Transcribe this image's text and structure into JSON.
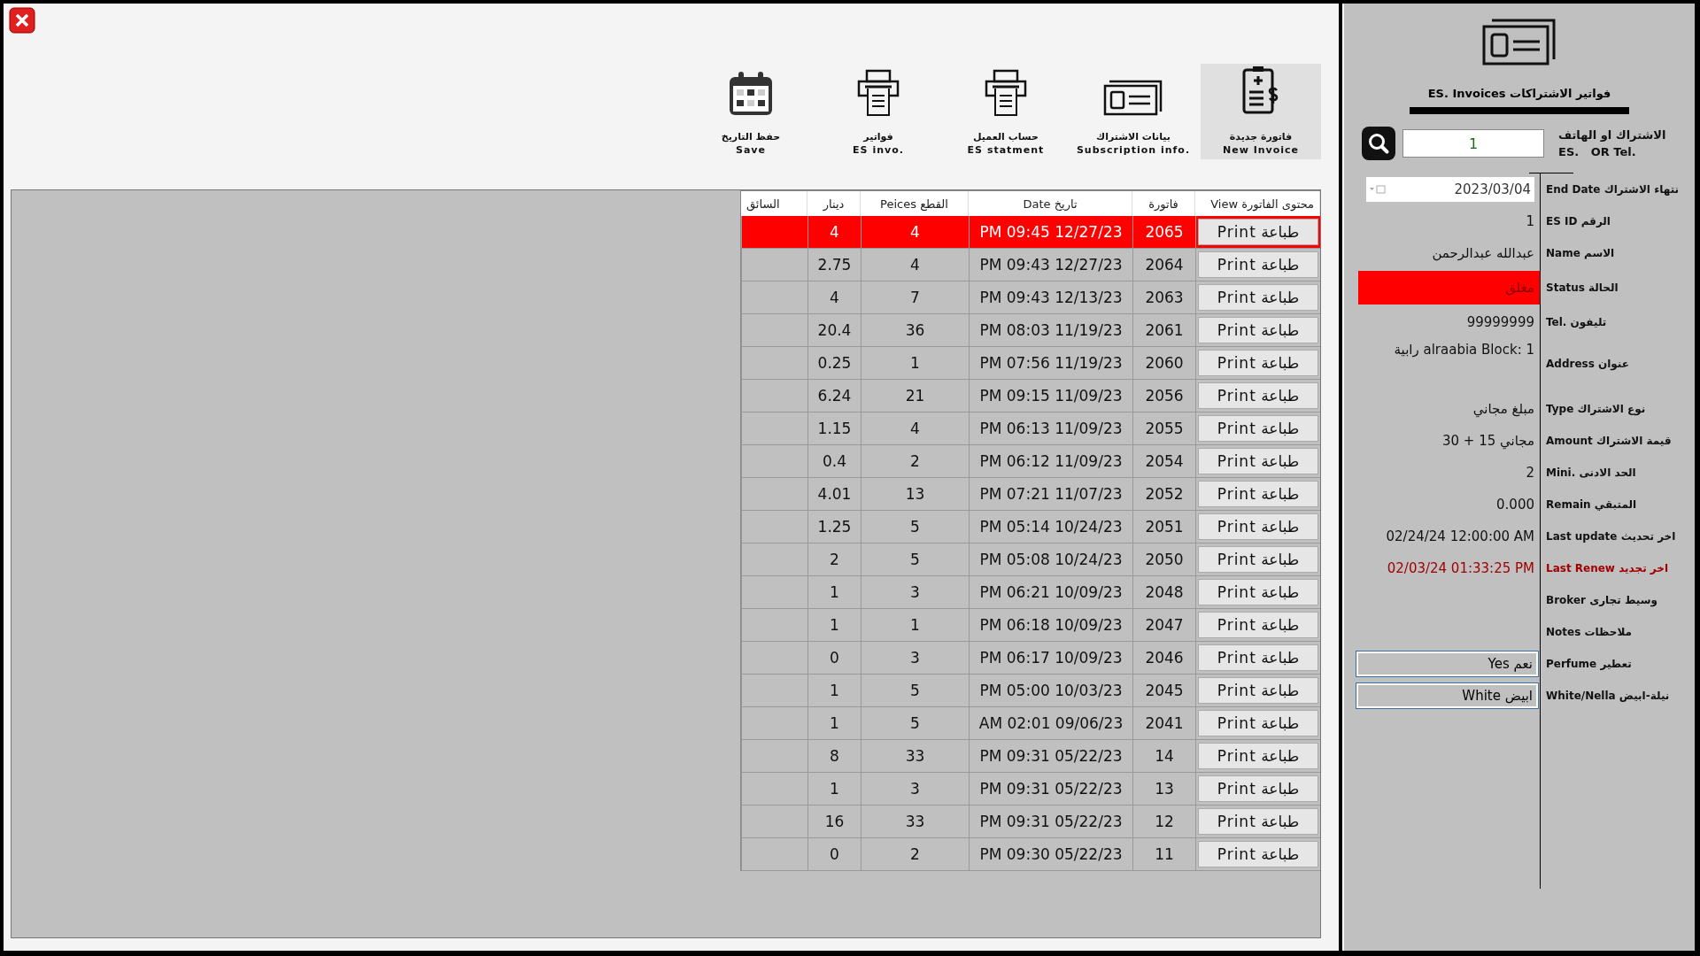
{
  "toolbar": [
    {
      "kind": "invoice",
      "label_ar": "فاتورة جديدة",
      "label_en": "New Invoice",
      "selected": true
    },
    {
      "kind": "card",
      "label_ar": "بيانات الاشتراك",
      "label_en": "Subscription info.",
      "selected": false
    },
    {
      "kind": "printer",
      "label_ar": "حساب العميل",
      "label_en": "ES statment",
      "selected": false
    },
    {
      "kind": "printer",
      "label_ar": "فواتير",
      "label_en": "ES invo.",
      "selected": false
    },
    {
      "kind": "calendar",
      "label_ar": "حفظ التاريخ",
      "label_en": "Save",
      "selected": false
    }
  ],
  "table": {
    "columns": [
      "محتوى الفاتورة View",
      "فاتورة",
      "تاريخ Date",
      "القطع Peices",
      "دينار",
      "السائق"
    ],
    "rows": [
      {
        "selected": true,
        "view": "طباعة Print",
        "invoice": "2065",
        "date": "PM 09:45 12/27/23",
        "pieces": "4",
        "dinar": "4"
      },
      {
        "selected": false,
        "view": "طباعة Print",
        "invoice": "2064",
        "date": "PM 09:43 12/27/23",
        "pieces": "4",
        "dinar": "2.75"
      },
      {
        "selected": false,
        "view": "طباعة Print",
        "invoice": "2063",
        "date": "PM 09:43 12/13/23",
        "pieces": "7",
        "dinar": "4"
      },
      {
        "selected": false,
        "view": "طباعة Print",
        "invoice": "2061",
        "date": "PM 08:03 11/19/23",
        "pieces": "36",
        "dinar": "20.4"
      },
      {
        "selected": false,
        "view": "طباعة Print",
        "invoice": "2060",
        "date": "PM 07:56 11/19/23",
        "pieces": "1",
        "dinar": "0.25"
      },
      {
        "selected": false,
        "view": "طباعة Print",
        "invoice": "2056",
        "date": "PM 09:15 11/09/23",
        "pieces": "21",
        "dinar": "6.24"
      },
      {
        "selected": false,
        "view": "طباعة Print",
        "invoice": "2055",
        "date": "PM 06:13 11/09/23",
        "pieces": "4",
        "dinar": "1.15"
      },
      {
        "selected": false,
        "view": "طباعة Print",
        "invoice": "2054",
        "date": "PM 06:12 11/09/23",
        "pieces": "2",
        "dinar": "0.4"
      },
      {
        "selected": false,
        "view": "طباعة Print",
        "invoice": "2052",
        "date": "PM 07:21 11/07/23",
        "pieces": "13",
        "dinar": "4.01"
      },
      {
        "selected": false,
        "view": "طباعة Print",
        "invoice": "2051",
        "date": "PM 05:14 10/24/23",
        "pieces": "5",
        "dinar": "1.25"
      },
      {
        "selected": false,
        "view": "طباعة Print",
        "invoice": "2050",
        "date": "PM 05:08 10/24/23",
        "pieces": "5",
        "dinar": "2"
      },
      {
        "selected": false,
        "view": "طباعة Print",
        "invoice": "2048",
        "date": "PM 06:21 10/09/23",
        "pieces": "3",
        "dinar": "1"
      },
      {
        "selected": false,
        "view": "طباعة Print",
        "invoice": "2047",
        "date": "PM 06:18 10/09/23",
        "pieces": "1",
        "dinar": "1"
      },
      {
        "selected": false,
        "view": "طباعة Print",
        "invoice": "2046",
        "date": "PM 06:17 10/09/23",
        "pieces": "3",
        "dinar": "0"
      },
      {
        "selected": false,
        "view": "طباعة Print",
        "invoice": "2045",
        "date": "PM 05:00 10/03/23",
        "pieces": "5",
        "dinar": "1"
      },
      {
        "selected": false,
        "view": "طباعة Print",
        "invoice": "2041",
        "date": "AM 02:01 09/06/23",
        "pieces": "5",
        "dinar": "1"
      },
      {
        "selected": false,
        "view": "طباعة Print",
        "invoice": "14",
        "date": "PM 09:31 05/22/23",
        "pieces": "33",
        "dinar": "8"
      },
      {
        "selected": false,
        "view": "طباعة Print",
        "invoice": "13",
        "date": "PM 09:31 05/22/23",
        "pieces": "3",
        "dinar": "1"
      },
      {
        "selected": false,
        "view": "طباعة Print",
        "invoice": "12",
        "date": "PM 09:31 05/22/23",
        "pieces": "33",
        "dinar": "16"
      },
      {
        "selected": false,
        "view": "طباعة Print",
        "invoice": "11",
        "date": "PM 09:30 05/22/23",
        "pieces": "2",
        "dinar": "0"
      }
    ]
  },
  "panel": {
    "title": "فواتير الاشتراكات ES. Invoices",
    "search": {
      "label_ar": "الاشتراك او الهاتف",
      "label_en": "ES.   OR Tel.",
      "value": "1"
    },
    "fields": [
      {
        "kind": "date",
        "label": "نتهاء الاشتراك End Date",
        "value": "2023/03/04"
      },
      {
        "kind": "text",
        "label": "الرقم ES ID",
        "value": "1"
      },
      {
        "kind": "text",
        "label": "الاسم Name",
        "value": "عبدالله عبدالرحمن"
      },
      {
        "kind": "status",
        "label": "الحالة Status",
        "value": "مغلق"
      },
      {
        "kind": "text",
        "label": "تليفون .Tel",
        "value": "99999999"
      },
      {
        "kind": "tall",
        "label": "عنوان Address",
        "value": "alraabia Block: 1 رابية"
      },
      {
        "kind": "text",
        "label": "نوع الاشتراك Type",
        "value": "مبلغ مجاني"
      },
      {
        "kind": "text",
        "label": "قيمة الاشتراك Amount",
        "value": "مجاني 15 + 30"
      },
      {
        "kind": "text",
        "label": "الحد الادنى .Mini",
        "value": "2"
      },
      {
        "kind": "text",
        "label": "المتبقي Remain",
        "value": "0.000"
      },
      {
        "kind": "ltr",
        "label": "اخر تحديث Last update",
        "value": "02/24/24 12:00:00 AM"
      },
      {
        "kind": "alert",
        "label": "اخر تجديد Last Renew",
        "value": "02/03/24 01:33:25 PM"
      },
      {
        "kind": "empty",
        "label": "وسيط تجارى Broker"
      },
      {
        "kind": "empty",
        "label": "ملاحظات Notes"
      },
      {
        "kind": "field",
        "label": "تعطير Perfume",
        "value": "نعم Yes"
      },
      {
        "kind": "field",
        "label": "نيلة-ابيض White/Nella",
        "value": "ابيض White"
      }
    ]
  }
}
